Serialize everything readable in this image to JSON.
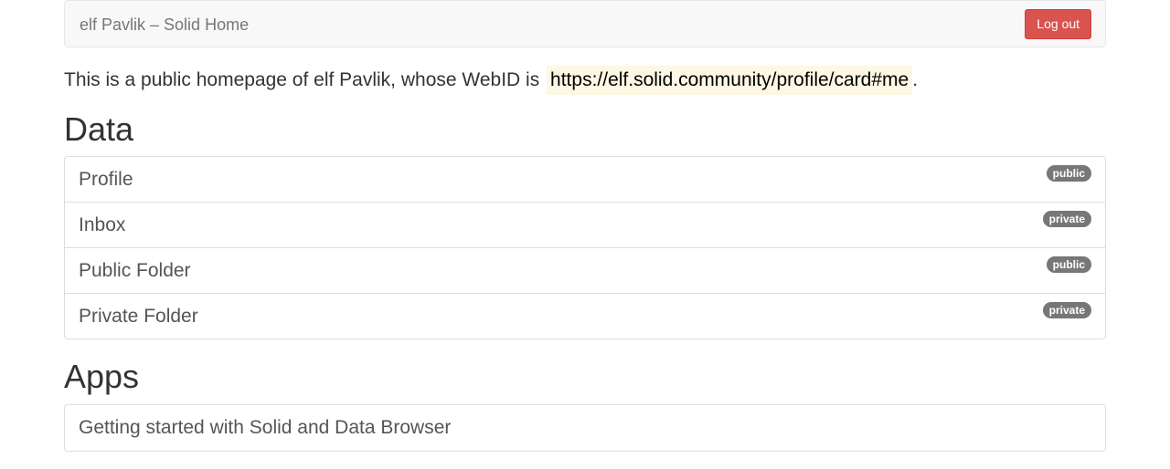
{
  "navbar": {
    "brand": "elf Pavlik – Solid Home",
    "logout_label": "Log out"
  },
  "intro": {
    "text": "This is a public homepage of elf Pavlik, whose WebID is",
    "webid": "https://elf.solid.community/profile/card#me",
    "suffix": "."
  },
  "data_section": {
    "heading": "Data",
    "items": [
      {
        "label": "Profile",
        "badge": "public"
      },
      {
        "label": "Inbox",
        "badge": "private"
      },
      {
        "label": "Public Folder",
        "badge": "public"
      },
      {
        "label": "Private Folder",
        "badge": "private"
      }
    ]
  },
  "apps_section": {
    "heading": "Apps",
    "items": [
      {
        "label": "Getting started with Solid and Data Browser"
      }
    ]
  },
  "colors": {
    "danger": "#d9534f",
    "badge": "#777777",
    "highlight": "#fcf8e3"
  }
}
